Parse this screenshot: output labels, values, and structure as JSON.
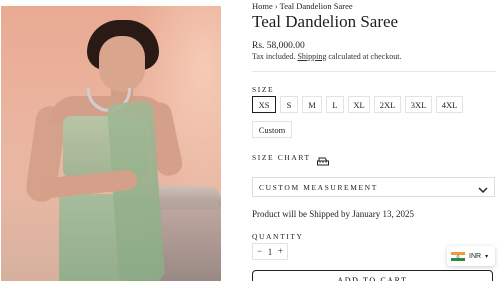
{
  "breadcrumb": {
    "home": "Home",
    "separator": "›",
    "current": "Teal Dandelion Saree"
  },
  "product": {
    "title": "Teal Dandelion Saree",
    "price": "Rs. 58,000.00",
    "tax_prefix": "Tax included.",
    "shipping_link": "Shipping",
    "tax_suffix": "calculated at checkout.",
    "image_alt_icon": "product-photo"
  },
  "size": {
    "label": "SIZE",
    "options": [
      "XS",
      "S",
      "M",
      "L",
      "XL",
      "2XL",
      "3XL",
      "4XL",
      "Custom"
    ],
    "selected": "XS"
  },
  "size_chart": {
    "label": "SIZE CHART",
    "icon": "ruler-icon"
  },
  "custom_measurement": {
    "label": "CUSTOM MEASUREMENT",
    "icon": "chevron-down-icon"
  },
  "shipping_note": "Product will be Shipped by January 13, 2025",
  "quantity": {
    "label": "QUANTITY",
    "minus": "−",
    "value": "1",
    "plus": "+"
  },
  "currency": {
    "code": "INR",
    "flag": "india-flag-icon",
    "caret": "▾"
  },
  "cart": {
    "label": "ADD TO CART"
  },
  "colors": {
    "text": "#1e1e1e",
    "border": "#e3e3e3",
    "selected_border": "#1e1e1e"
  }
}
